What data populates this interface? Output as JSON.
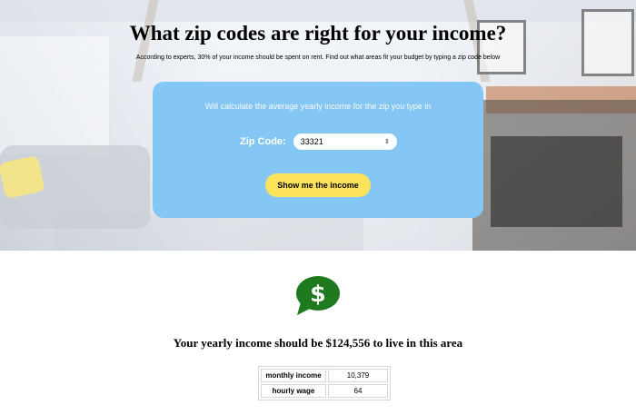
{
  "header": {
    "title": "What zip codes are right for your income?",
    "subtitle": "According to experts, 30% of your income should be spent on rent. Find out what areas fit your budget by typing a zip code below"
  },
  "calculator": {
    "hint": "Will calculate the average yearly income for the zip you type in",
    "zip_label": "Zip Code:",
    "zip_value": "33321",
    "button_label": "Show me the income"
  },
  "result": {
    "icon": "dollar-chat-bubble-icon",
    "text": "Your yearly income should be $124,556 to live in this area",
    "rows": [
      {
        "label": "monthly income",
        "value": "10,379"
      },
      {
        "label": "hourly wage",
        "value": "64"
      }
    ]
  },
  "colors": {
    "panel": "#85c7f4",
    "button": "#fce35b",
    "icon": "#1f7a1f"
  }
}
